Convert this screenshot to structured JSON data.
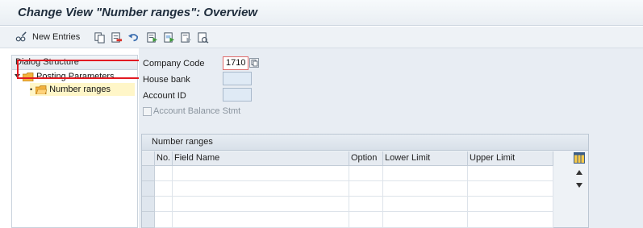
{
  "window": {
    "title": "Change View \"Number ranges\": Overview"
  },
  "toolbar": {
    "new_entries_label": "New Entries",
    "icons": [
      "glasses-pencil-icon",
      "copy-icon",
      "delete-icon",
      "undo-icon",
      "select-all-icon",
      "select-block-icon",
      "deselect-all-icon",
      "print-icon"
    ]
  },
  "dialog_structure": {
    "header": "Dialog Structure",
    "items": [
      {
        "label": "Posting Parameters",
        "level": 0
      },
      {
        "label": "Number ranges",
        "level": 1,
        "selected": true
      }
    ]
  },
  "form": {
    "company_code_label": "Company Code",
    "company_code_value": "1710",
    "house_bank_label": "House bank",
    "house_bank_value": "",
    "account_id_label": "Account ID",
    "account_id_value": "",
    "account_balance_label": "Account Balance Stmt",
    "account_balance_checked": false
  },
  "table": {
    "caption": "Number ranges",
    "columns": [
      "No.",
      "Field Name",
      "Option",
      "Lower Limit",
      "Upper Limit"
    ],
    "rows": [
      [],
      [],
      [],
      []
    ]
  },
  "colors": {
    "highlight": "#e21a22",
    "selected_row": "#fff6c8",
    "folder": "#f3b23d"
  }
}
